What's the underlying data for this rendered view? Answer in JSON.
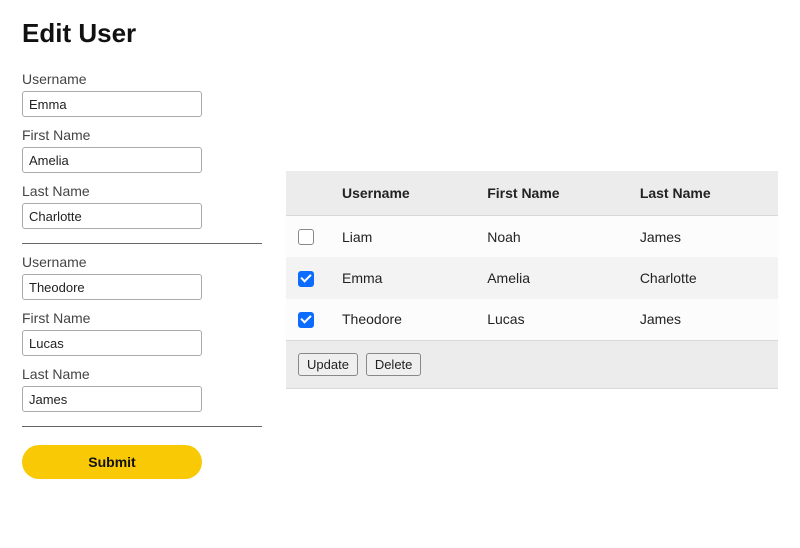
{
  "title": "Edit User",
  "form": {
    "groups": [
      {
        "fields": [
          {
            "label": "Username",
            "value": "Emma"
          },
          {
            "label": "First Name",
            "value": "Amelia"
          },
          {
            "label": "Last Name",
            "value": "Charlotte"
          }
        ]
      },
      {
        "fields": [
          {
            "label": "Username",
            "value": "Theodore"
          },
          {
            "label": "First Name",
            "value": "Lucas"
          },
          {
            "label": "Last Name",
            "value": "James"
          }
        ]
      }
    ],
    "submit_label": "Submit"
  },
  "table": {
    "columns": [
      "Username",
      "First Name",
      "Last Name"
    ],
    "rows": [
      {
        "checked": false,
        "username": "Liam",
        "first_name": "Noah",
        "last_name": "James"
      },
      {
        "checked": true,
        "username": "Emma",
        "first_name": "Amelia",
        "last_name": "Charlotte"
      },
      {
        "checked": true,
        "username": "Theodore",
        "first_name": "Lucas",
        "last_name": "James"
      }
    ],
    "actions": {
      "update": "Update",
      "delete": "Delete"
    }
  }
}
